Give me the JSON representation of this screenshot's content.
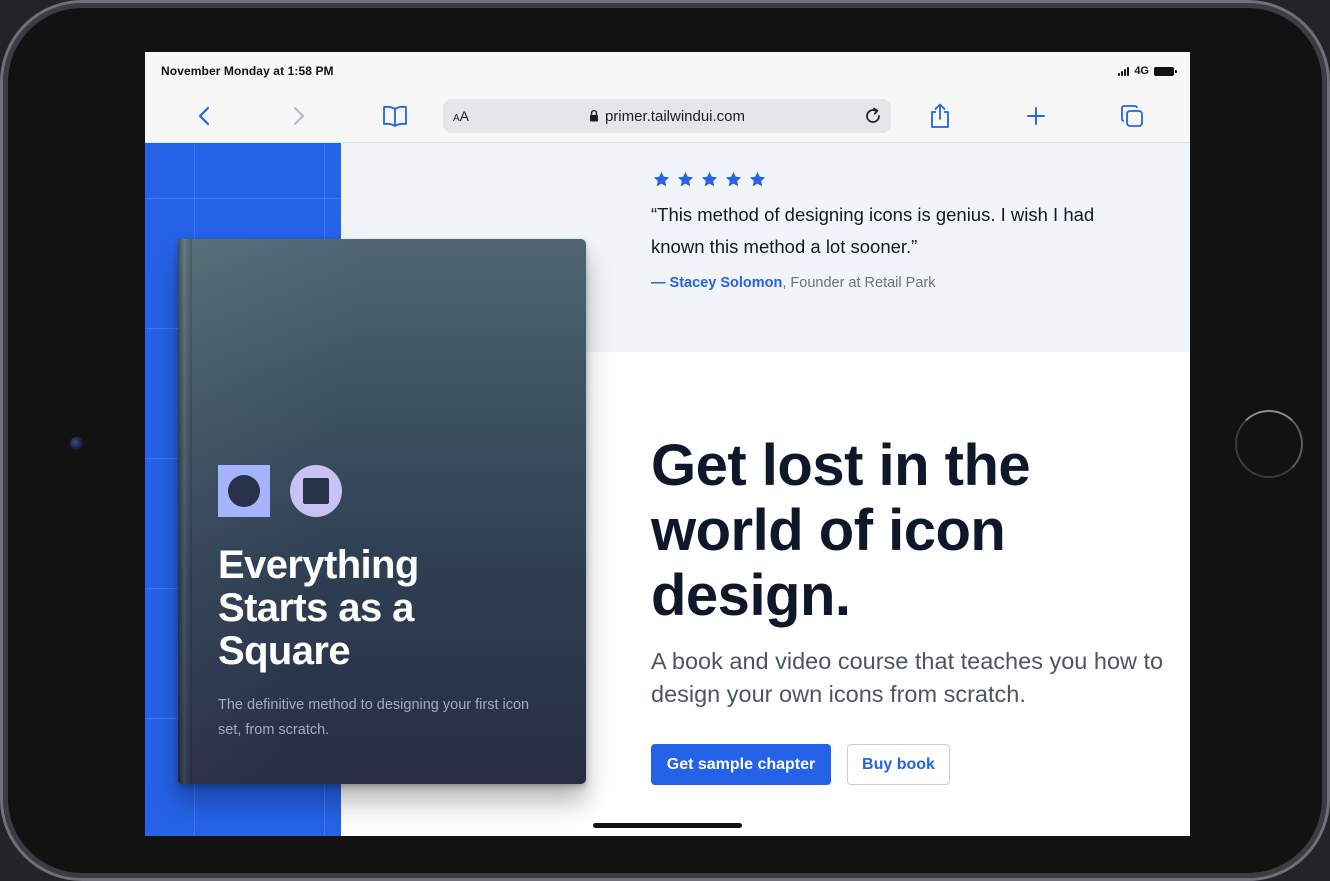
{
  "status_bar": {
    "time": "November Monday at 1:58 PM",
    "network": "4G"
  },
  "toolbar": {
    "back_icon": "chevron-left-icon",
    "forward_icon": "chevron-right-icon",
    "bookmarks_icon": "book-icon",
    "text_size_label": "AA",
    "url": "primer.tailwindui.com",
    "reload_icon": "reload-icon",
    "share_icon": "share-icon",
    "new_tab_icon": "plus-icon",
    "tabs_icon": "tabs-icon"
  },
  "testimonial": {
    "rating": 5,
    "quote": "“This method of designing icons is genius. I wish I had known this method a lot sooner.”",
    "author": "— Stacey Solomon",
    "role": ", Founder at Retail Park"
  },
  "hero": {
    "headline": "Get lost in the world of icon design.",
    "lead": "A book and video course that teaches you how to design your own icons from scratch.",
    "primary_button": "Get sample chapter",
    "secondary_button": "Buy book"
  },
  "book": {
    "title": "Everything Starts as a Square",
    "subtitle": "The definitive method to designing your first icon set, from scratch."
  },
  "colors": {
    "brand_blue": "#2462e8",
    "headline": "#0f172a",
    "testimonial_bg": "#f1f4f9"
  }
}
